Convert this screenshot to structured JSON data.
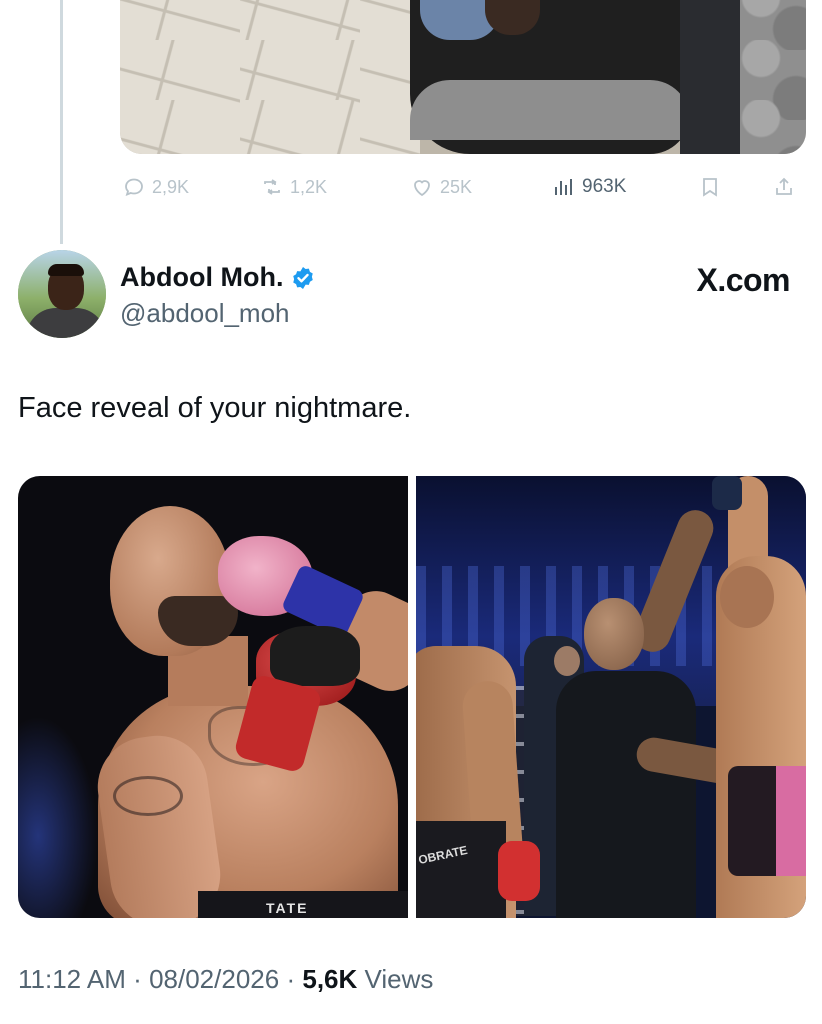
{
  "previous_tweet": {
    "actions": {
      "replies": "2,9K",
      "retweets": "1,2K",
      "likes": "25K",
      "views": "963K"
    }
  },
  "tweet": {
    "author": {
      "name": "Abdool Moh.",
      "handle": "@abdool_moh",
      "verified": true
    },
    "watermark": "X.com",
    "text": "Face reveal of your nightmare.",
    "left_image_shorts_text": "TATE",
    "right_image_shorts_text": "OBRATE",
    "meta": {
      "time": "11:12 AM",
      "separator": "·",
      "date": "08/02/2026",
      "views_count": "5,6K",
      "views_label": "Views"
    }
  },
  "colors": {
    "text_primary": "#0f1419",
    "text_secondary": "#536471",
    "faded_actions": "#b8c3ca",
    "verified_blue": "#1d9bf0"
  },
  "icons": [
    "reply-icon",
    "retweet-icon",
    "like-icon",
    "views-icon",
    "bookmark-icon",
    "share-icon",
    "verified-badge-icon"
  ]
}
